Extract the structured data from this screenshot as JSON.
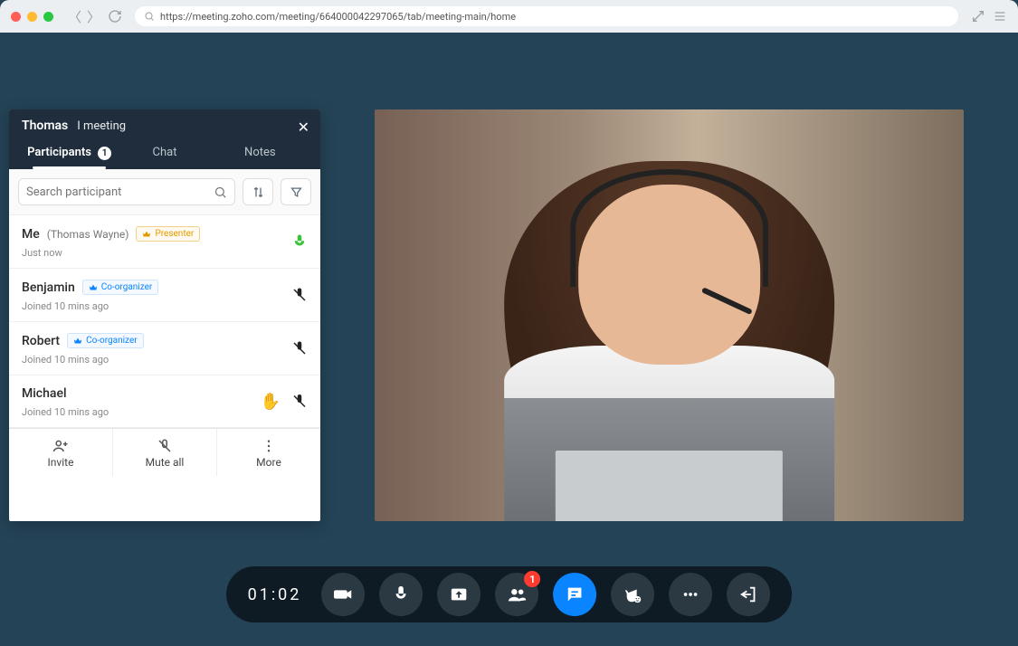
{
  "browser": {
    "url": "https://meeting.zoho.com/meeting/664000042297065/tab/meeting-main/home"
  },
  "panel": {
    "owner": "Thomas",
    "title_suffix": "I meeting",
    "tabs": {
      "participants": "Participants",
      "participants_count": "1",
      "chat": "Chat",
      "notes": "Notes"
    },
    "search_placeholder": "Search participant",
    "participants": [
      {
        "name": "Me",
        "sub": "(Thomas Wayne)",
        "badge": "Presenter",
        "badge_kind": "presenter",
        "joined": "Just now",
        "mic": "active"
      },
      {
        "name": "Benjamin",
        "sub": "",
        "badge": "Co-organizer",
        "badge_kind": "co",
        "joined": "Joined 10 mins ago",
        "mic": "muted"
      },
      {
        "name": "Robert",
        "sub": "",
        "badge": "Co-organizer",
        "badge_kind": "co",
        "joined": "Joined 10 mins ago",
        "mic": "muted"
      },
      {
        "name": "Michael",
        "sub": "",
        "badge": "",
        "badge_kind": "",
        "joined": "Joined 10 mins ago",
        "mic": "muted",
        "hand": true
      }
    ],
    "actions": {
      "invite": "Invite",
      "mute_all": "Mute all",
      "more": "More"
    }
  },
  "toolbar": {
    "timer": "01:02",
    "participants_badge": "1"
  }
}
